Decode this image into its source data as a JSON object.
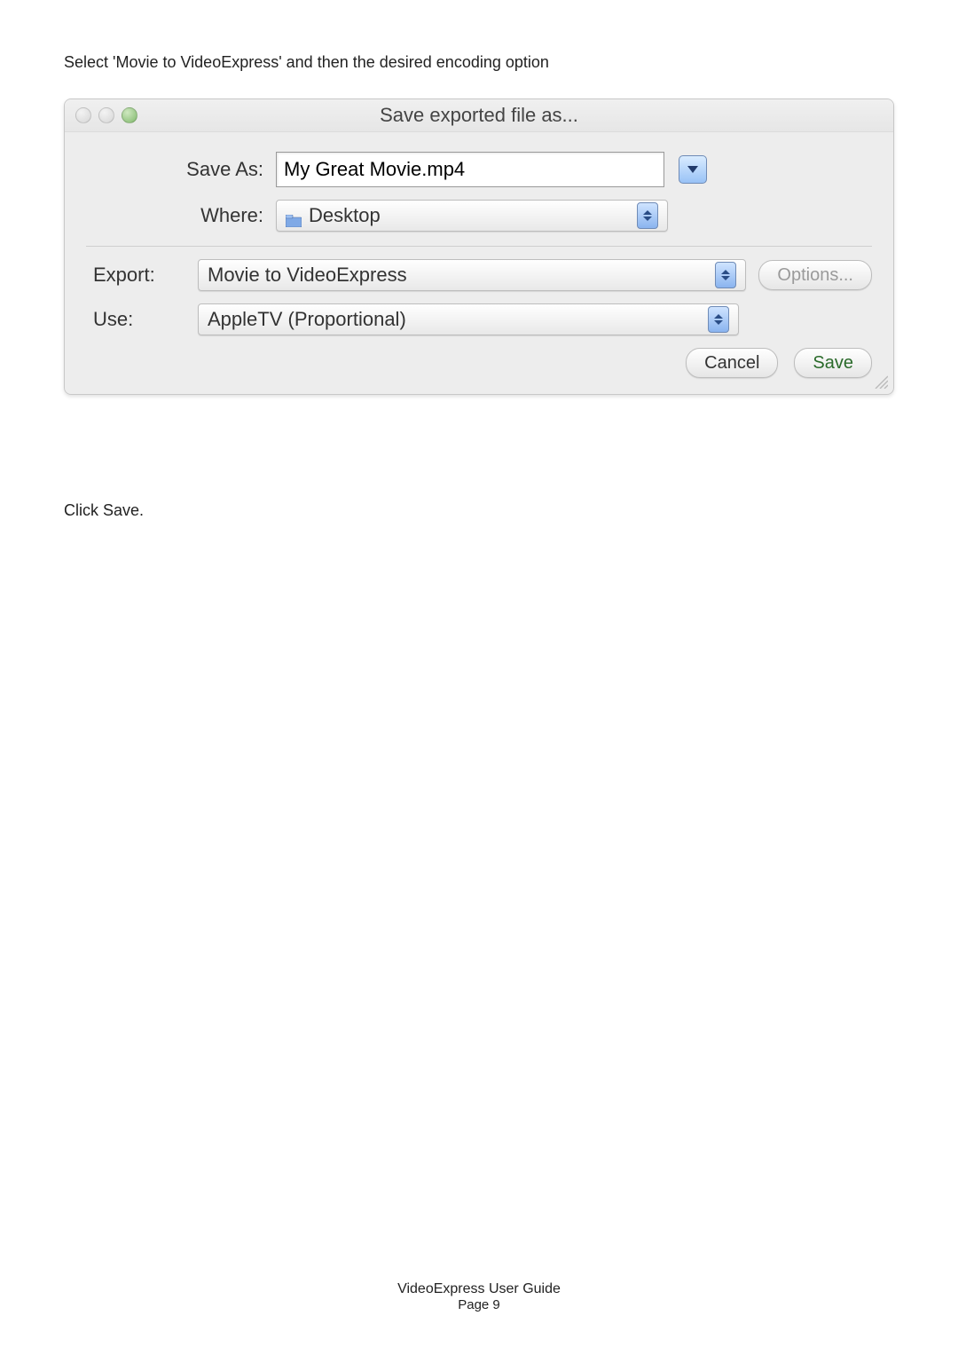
{
  "instruction": "Select 'Movie to VideoExpress' and then the desired encoding option",
  "dialog": {
    "title": "Save exported file as...",
    "save_as_label": "Save As:",
    "save_as_value": "My Great Movie.mp4",
    "where_label": "Where:",
    "where_value": "Desktop",
    "export_label": "Export:",
    "export_value": "Movie to VideoExpress",
    "use_label": "Use:",
    "use_value": "AppleTV (Proportional)",
    "options_label": "Options...",
    "cancel_label": "Cancel",
    "save_label": "Save",
    "icons": {
      "traffic_close": "close-icon",
      "traffic_min": "minimize-icon",
      "traffic_zoom": "zoom-icon",
      "folder": "folder-icon",
      "disclosure": "chevron-down-icon",
      "stepper": "stepper-icon",
      "resize": "resize-grip-icon"
    }
  },
  "after_text": "Click Save.",
  "footer": {
    "title": "VideoExpress User Guide",
    "page": "Page 9"
  }
}
